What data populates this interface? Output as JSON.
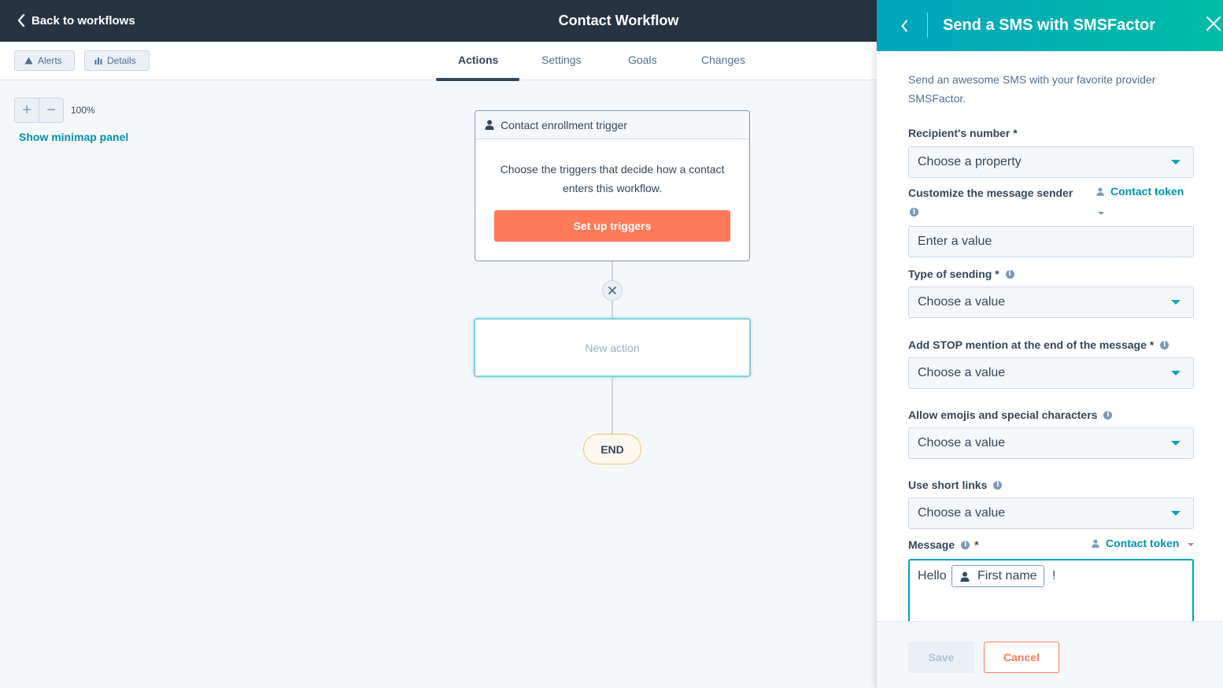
{
  "topbar": {
    "back_label": "Back to workflows",
    "title": "Contact Workflow"
  },
  "toolbar": {
    "alerts_label": "Alerts",
    "details_label": "Details"
  },
  "tabs": [
    {
      "label": "Actions",
      "active": true
    },
    {
      "label": "Settings",
      "active": false
    },
    {
      "label": "Goals",
      "active": false
    },
    {
      "label": "Changes",
      "active": false
    }
  ],
  "canvas": {
    "zoom_plus": "+",
    "zoom_minus": "−",
    "zoom_level": "100%",
    "minimap_link": "Show minimap panel",
    "trigger": {
      "header": "Contact enrollment trigger",
      "description": "Choose the triggers that decide how a contact enters this workflow.",
      "button": "Set up triggers"
    },
    "new_action_label": "New action",
    "end_label": "END"
  },
  "panel": {
    "title": "Send a SMS with SMSFactor",
    "intro": "Send an awesome SMS with your favorite provider SMSFactor.",
    "fields": {
      "recipient_label": "Recipient's number *",
      "recipient_value": "Choose a property",
      "sender_label": "Customize the message sender",
      "sender_placeholder": "Enter a value",
      "sending_type_label": "Type of sending *",
      "sending_type_value": "Choose a value",
      "stop_label": "Add STOP mention at the end of the message *",
      "stop_value": "Choose a value",
      "emoji_label": "Allow emojis and special characters",
      "emoji_value": "Choose a value",
      "shortlinks_label": "Use short links",
      "shortlinks_value": "Choose a value",
      "message_label": "Message",
      "message_required": "*"
    },
    "contact_token_label": "Contact token",
    "message": {
      "prefix": "Hello",
      "token": "First name",
      "suffix": "!"
    },
    "footer": {
      "save_label": "Save",
      "cancel_label": "Cancel"
    }
  },
  "colors": {
    "topbar": "#253342",
    "accent_teal": "#00a4bd",
    "accent_orange": "#ff7a59",
    "link": "#0091ae"
  },
  "icons": [
    "chevron-left-icon",
    "warning-icon",
    "bar-chart-icon",
    "user-icon",
    "close-icon",
    "info-icon",
    "caret-down-icon"
  ]
}
